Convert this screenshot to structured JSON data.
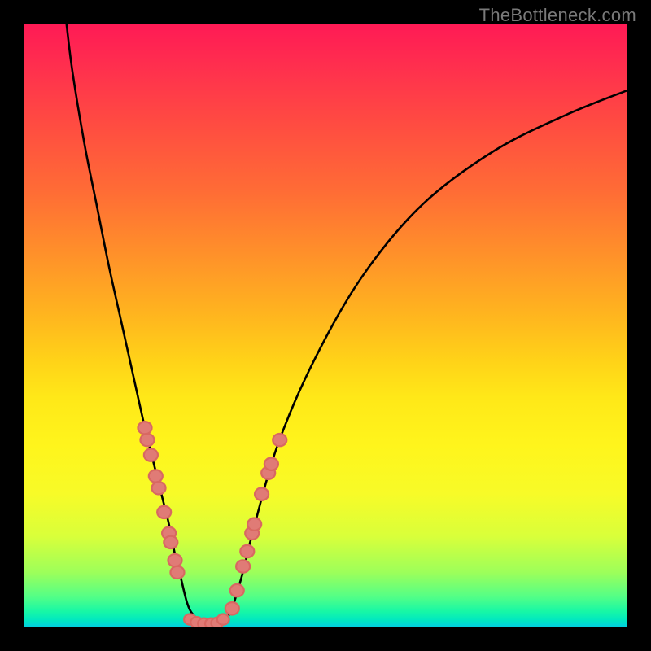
{
  "watermark": "TheBottleneck.com",
  "chart_data": {
    "type": "line",
    "title": "",
    "xlabel": "",
    "ylabel": "",
    "xlim": [
      0,
      100
    ],
    "ylim": [
      0,
      100
    ],
    "series": [
      {
        "name": "curve",
        "color": "#000000",
        "x": [
          7,
          8,
          10,
          12,
          14,
          16,
          18,
          20,
          21,
          22,
          23,
          24,
          25,
          26,
          27,
          28,
          30,
          32,
          34,
          36,
          38,
          42,
          48,
          56,
          66,
          78,
          90,
          100
        ],
        "y": [
          100,
          92,
          80,
          70,
          60,
          51,
          42,
          33,
          29,
          25,
          21,
          17,
          12,
          8,
          4,
          2,
          0.5,
          0.5,
          2,
          8,
          16,
          30,
          44,
          58,
          70,
          79,
          85,
          89
        ]
      }
    ],
    "points_left": [
      {
        "x": 20.0,
        "y": 33
      },
      {
        "x": 20.4,
        "y": 31
      },
      {
        "x": 21.0,
        "y": 28.5
      },
      {
        "x": 21.8,
        "y": 25
      },
      {
        "x": 22.3,
        "y": 23
      },
      {
        "x": 23.2,
        "y": 19
      },
      {
        "x": 24.0,
        "y": 15.5
      },
      {
        "x": 24.3,
        "y": 14
      },
      {
        "x": 25.0,
        "y": 11
      },
      {
        "x": 25.4,
        "y": 9
      }
    ],
    "points_right": [
      {
        "x": 34.5,
        "y": 3
      },
      {
        "x": 35.3,
        "y": 6
      },
      {
        "x": 36.3,
        "y": 10
      },
      {
        "x": 37.0,
        "y": 12.5
      },
      {
        "x": 37.8,
        "y": 15.5
      },
      {
        "x": 38.2,
        "y": 17
      },
      {
        "x": 39.4,
        "y": 22
      },
      {
        "x": 40.5,
        "y": 25.5
      },
      {
        "x": 41.0,
        "y": 27
      },
      {
        "x": 42.4,
        "y": 31
      }
    ],
    "points_bottom": [
      {
        "x": 27.5,
        "y": 1.2
      },
      {
        "x": 28.6,
        "y": 0.7
      },
      {
        "x": 29.8,
        "y": 0.5
      },
      {
        "x": 31.0,
        "y": 0.5
      },
      {
        "x": 32.0,
        "y": 0.6
      },
      {
        "x": 33.0,
        "y": 1.2
      }
    ]
  }
}
